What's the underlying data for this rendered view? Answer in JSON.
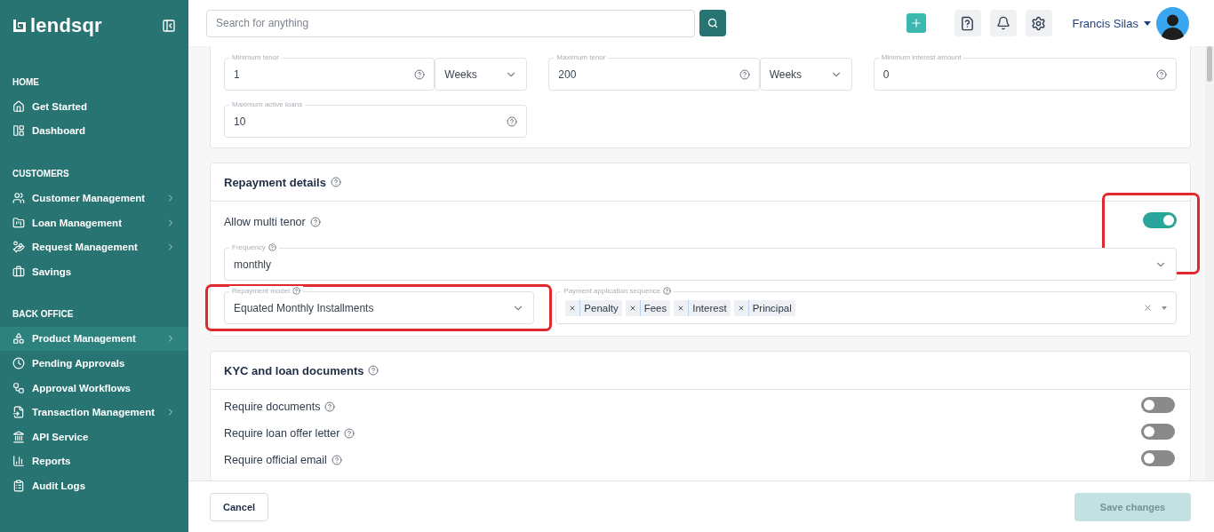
{
  "brand": {
    "name": "lendsqr"
  },
  "search": {
    "placeholder": "Search for anything"
  },
  "user": {
    "name": "Francis Silas"
  },
  "sidebar": {
    "sections": [
      {
        "heading": "HOME",
        "items": [
          {
            "label": "Get Started",
            "selected": false,
            "has_submenu": false
          },
          {
            "label": "Dashboard",
            "selected": false,
            "has_submenu": false
          }
        ]
      },
      {
        "heading": "CUSTOMERS",
        "items": [
          {
            "label": "Customer Management",
            "selected": false,
            "has_submenu": true
          },
          {
            "label": "Loan Management",
            "selected": false,
            "has_submenu": true
          },
          {
            "label": "Request Management",
            "selected": false,
            "has_submenu": true
          },
          {
            "label": "Savings",
            "selected": false,
            "has_submenu": false
          }
        ]
      },
      {
        "heading": "BACK OFFICE",
        "items": [
          {
            "label": "Product Management",
            "selected": true,
            "has_submenu": true
          },
          {
            "label": "Pending Approvals",
            "selected": false,
            "has_submenu": false
          },
          {
            "label": "Approval Workflows",
            "selected": false,
            "has_submenu": false
          },
          {
            "label": "Transaction Management",
            "selected": false,
            "has_submenu": true
          },
          {
            "label": "API Service",
            "selected": false,
            "has_submenu": false
          },
          {
            "label": "Reports",
            "selected": false,
            "has_submenu": false
          },
          {
            "label": "Audit Logs",
            "selected": false,
            "has_submenu": false
          }
        ]
      }
    ]
  },
  "limits": {
    "fields": [
      {
        "label": "Minimum tenor",
        "value": "1",
        "unit": "Weeks"
      },
      {
        "label": "Maximum tenor",
        "value": "200",
        "unit": "Weeks"
      },
      {
        "label": "Minimum interest amount",
        "value": "0"
      },
      {
        "label": "Maximum active loans",
        "value": "10"
      }
    ]
  },
  "repayment": {
    "title": "Repayment details",
    "multi_tenor": {
      "label": "Allow multi tenor",
      "on": true,
      "highlighted": true
    },
    "frequency": {
      "label": "Frequency",
      "value": "monthly"
    },
    "repayment_model": {
      "label": "Repayment model",
      "value": "Equated Monthly Installments",
      "highlighted": true
    },
    "payment_sequence": {
      "label": "Payment application sequence",
      "tags": [
        "Penalty",
        "Fees",
        "Interest",
        "Principal"
      ]
    }
  },
  "documents": {
    "title": "KYC and loan documents",
    "toggles": [
      {
        "label": "Require documents",
        "on": false
      },
      {
        "label": "Require loan offer letter",
        "on": false
      },
      {
        "label": "Require official email",
        "on": false
      }
    ]
  },
  "footer": {
    "buttons": [
      {
        "label": "Cancel",
        "kind": "secondary",
        "disabled": false
      },
      {
        "label": "Save changes",
        "kind": "primary",
        "disabled": true
      }
    ]
  }
}
